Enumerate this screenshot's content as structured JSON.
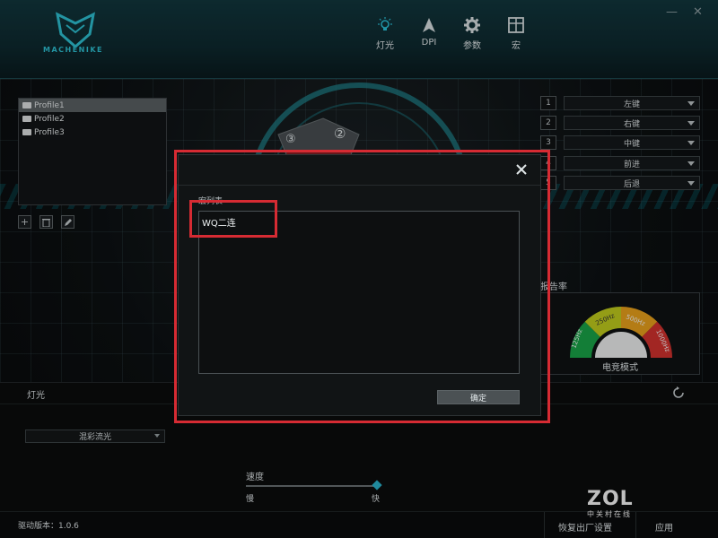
{
  "header": {
    "logo_text": "MACHENIKE",
    "nav": [
      {
        "label": "灯光",
        "icon": "bulb-icon"
      },
      {
        "label": "DPI",
        "icon": "arrow-icon"
      },
      {
        "label": "参数",
        "icon": "gear-icon"
      },
      {
        "label": "宏",
        "icon": "grid-icon"
      }
    ],
    "window_controls": {
      "minimize": "—",
      "close": "✕"
    }
  },
  "profiles": [
    "Profile1",
    "Profile2",
    "Profile3"
  ],
  "active_profile": "Profile1",
  "mouse_badges": [
    "③",
    "②"
  ],
  "button_mapping": [
    {
      "num": "1",
      "action": "左键"
    },
    {
      "num": "2",
      "action": "右键"
    },
    {
      "num": "3",
      "action": "中键"
    },
    {
      "num": "4",
      "action": "前进"
    },
    {
      "num": "5",
      "action": "后退"
    }
  ],
  "report_rate": {
    "label": "报告率",
    "rates": [
      "125Hz",
      "250Hz",
      "500Hz",
      "1000Hz"
    ],
    "mode": "电竞模式",
    "colors": [
      "#1aa84a",
      "#c6d21e",
      "#f0a61c",
      "#d9332f"
    ]
  },
  "lighting": {
    "title": "灯光",
    "effect": "混彩流光",
    "speed_label": "速度",
    "slow": "慢",
    "fast": "快",
    "speed_value": 1.0
  },
  "footer": {
    "version": "驱动版本：1.0.6",
    "restore": "恢复出厂设置",
    "apply": "应用"
  },
  "watermark": {
    "main": "ZOL",
    "sub": "中关村在线"
  },
  "modal": {
    "label": "宏列表",
    "macros": [
      "WQ二连"
    ],
    "ok": "确定",
    "highlight_color": "#d62b33"
  },
  "accent": "#2bb8d2"
}
